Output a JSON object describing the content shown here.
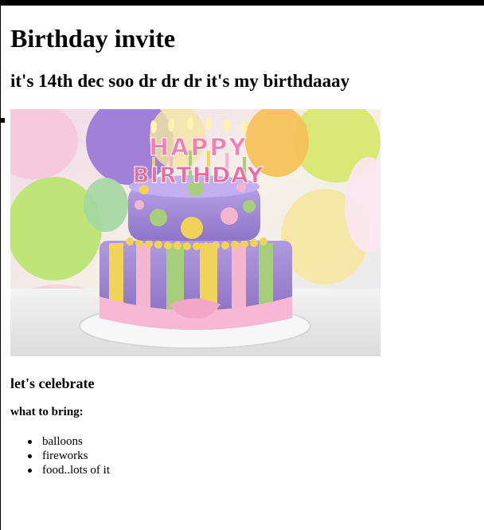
{
  "page": {
    "title": "Birthday invite",
    "subtitle": "it's 14th dec soo dr dr dr it's my birthdaaay",
    "image": {
      "subject": "birthday-cake-photo",
      "cake_top_letters": "HAPPY",
      "cake_bottom_letters": "BIRTHDAY"
    },
    "celebrate_heading": "let's celebrate",
    "bring_heading": "what to bring:",
    "bring_items": [
      "balloons",
      "fireworks",
      "food..lots of it"
    ]
  },
  "colors": {
    "background": "#ffffff",
    "text": "#000000",
    "cake_purple": "#a48bd6",
    "cake_pink": "#f4b5cf",
    "cake_yellow": "#f2d35a",
    "cake_green": "#a7cf7b"
  }
}
